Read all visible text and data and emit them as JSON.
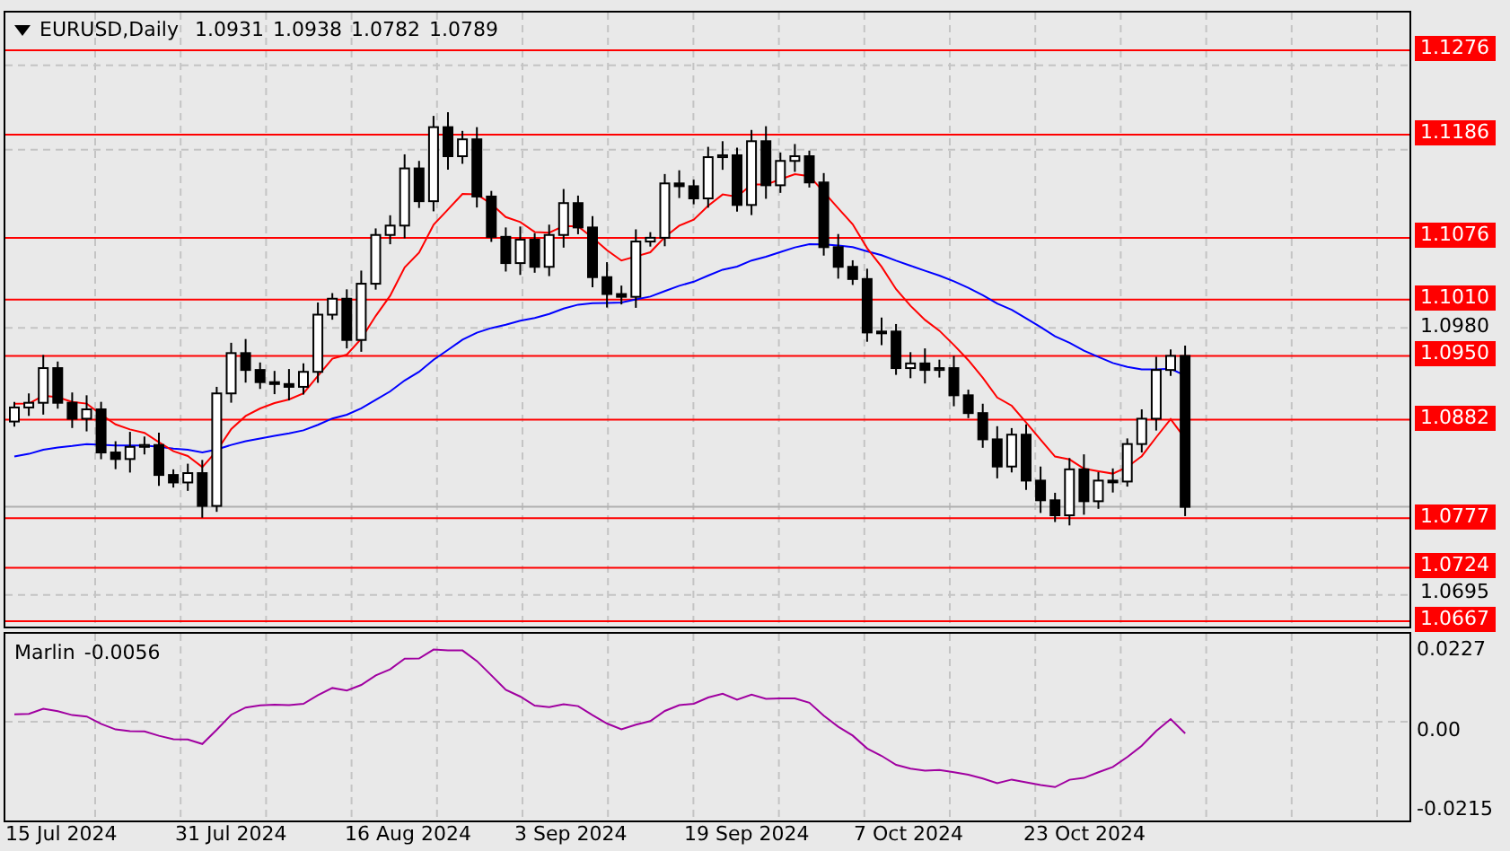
{
  "header": {
    "symbol": "EURUSD,Daily",
    "ohlc": [
      "1.0931",
      "1.0938",
      "1.0782",
      "1.0789"
    ]
  },
  "price_levels": [
    {
      "label": "1.1276"
    },
    {
      "label": "1.1186"
    },
    {
      "label": "1.1076"
    },
    {
      "label": "1.1010"
    },
    {
      "label": "1.0950"
    },
    {
      "label": "1.0882"
    },
    {
      "label": "1.0777"
    },
    {
      "label": "1.0724"
    },
    {
      "label": "1.0667"
    }
  ],
  "price_ticks": [
    "1.0980",
    "1.0695"
  ],
  "indicator": {
    "name": "Marlin",
    "value": "-0.0056",
    "ticks": [
      "0.0227",
      "0.00",
      "-0.0215"
    ]
  },
  "date_axis": [
    "15 Jul 2024",
    "31 Jul 2024",
    "16 Aug 2024",
    "3 Sep 2024",
    "19 Sep 2024",
    "7 Oct 2024",
    "23 Oct 2024"
  ]
}
